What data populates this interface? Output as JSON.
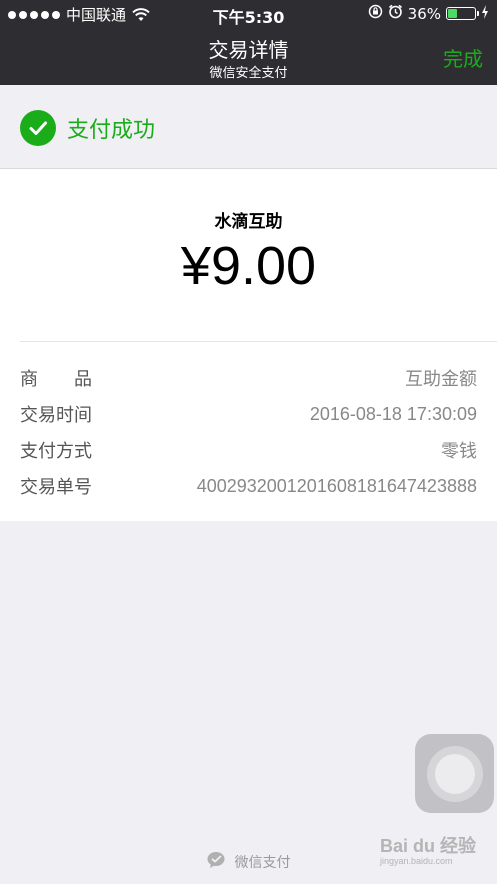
{
  "status_bar": {
    "carrier": "中国联通",
    "time": "下午5:30",
    "battery_percent": "36%",
    "battery_level": 0.36
  },
  "nav": {
    "title": "交易详情",
    "subtitle": "微信安全支付",
    "done_label": "完成"
  },
  "status": {
    "text": "支付成功",
    "color": "#1aad19"
  },
  "payment": {
    "merchant": "水滴互助",
    "amount": "¥9.00"
  },
  "details": [
    {
      "label": "商　　品",
      "value": "互助金额"
    },
    {
      "label": "交易时间",
      "value": "2016-08-18 17:30:09"
    },
    {
      "label": "支付方式",
      "value": "零钱"
    },
    {
      "label": "交易单号",
      "value": "4002932001201608181647423888"
    }
  ],
  "footer": {
    "text": "微信支付"
  },
  "watermark": {
    "text": "Bai du 经验",
    "sub": "jingyan.baidu.com"
  }
}
